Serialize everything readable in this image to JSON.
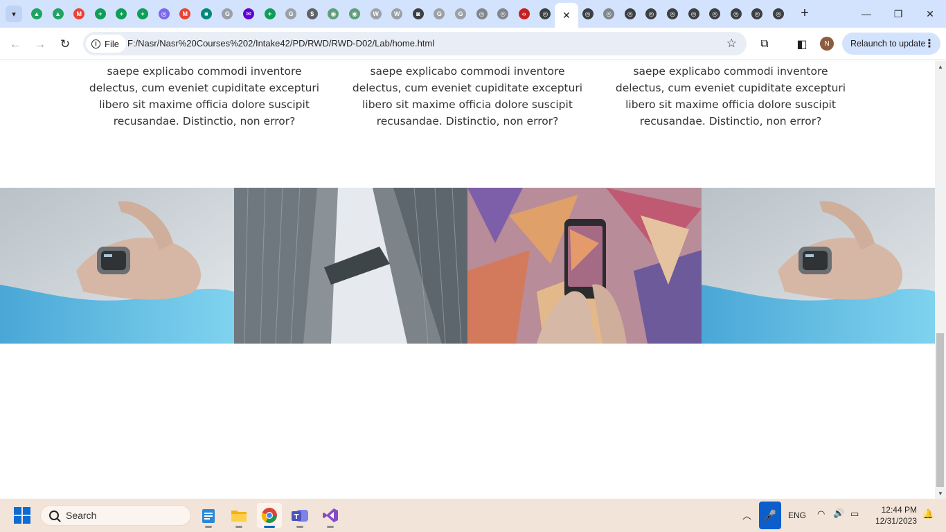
{
  "browser": {
    "tabs": [
      {
        "icon": "google-drive-icon",
        "color": "#1fa463",
        "glyph": "▲"
      },
      {
        "icon": "google-drive-icon",
        "color": "#1fa463",
        "glyph": "▲"
      },
      {
        "icon": "gmail-icon",
        "color": "#ea4335",
        "glyph": "M"
      },
      {
        "icon": "google-sheets-icon",
        "color": "#0f9d58",
        "glyph": "+"
      },
      {
        "icon": "google-sheets-icon",
        "color": "#0f9d58",
        "glyph": "+"
      },
      {
        "icon": "google-sheets-icon",
        "color": "#0f9d58",
        "glyph": "+"
      },
      {
        "icon": "extension-icon",
        "color": "#7b68ee",
        "glyph": "◎"
      },
      {
        "icon": "gmail-icon",
        "color": "#ea4335",
        "glyph": "M"
      },
      {
        "icon": "google-meet-icon",
        "color": "#00897b",
        "glyph": "■"
      },
      {
        "icon": "google-icon",
        "color": "#9aa0a6",
        "glyph": "G"
      },
      {
        "icon": "yahoo-mail-icon",
        "color": "#6001d2",
        "glyph": "✉"
      },
      {
        "icon": "google-sheets-icon",
        "color": "#0f9d58",
        "glyph": "+"
      },
      {
        "icon": "google-icon",
        "color": "#9aa0a6",
        "glyph": "G"
      },
      {
        "icon": "dollar-icon",
        "color": "#5f6368",
        "glyph": "$"
      },
      {
        "icon": "site-icon",
        "color": "#5f9e7a",
        "glyph": "◉"
      },
      {
        "icon": "site-icon",
        "color": "#5f9e7a",
        "glyph": "◉"
      },
      {
        "icon": "wikipedia-icon",
        "color": "#9aa0a6",
        "glyph": "W"
      },
      {
        "icon": "wikipedia-icon",
        "color": "#9aa0a6",
        "glyph": "W"
      },
      {
        "icon": "site-icon",
        "color": "#3c4043",
        "glyph": "◙"
      },
      {
        "icon": "google-icon",
        "color": "#9aa0a6",
        "glyph": "G"
      },
      {
        "icon": "site-icon",
        "color": "#9aa0a6",
        "glyph": "G"
      },
      {
        "icon": "chrome-icon",
        "color": "#80868b",
        "glyph": "◎"
      },
      {
        "icon": "chrome-icon",
        "color": "#80868b",
        "glyph": "◎"
      },
      {
        "icon": "code-icon",
        "color": "#c5221f",
        "glyph": "‹›"
      },
      {
        "icon": "chrome-icon",
        "color": "#3c4043",
        "glyph": "◎"
      },
      {
        "icon": "close-icon",
        "color": "#1f1f1f",
        "glyph": "✕",
        "active": true
      },
      {
        "icon": "chrome-icon",
        "color": "#3c4043",
        "glyph": "◎"
      },
      {
        "icon": "chrome-icon",
        "color": "#80868b",
        "glyph": "◎"
      },
      {
        "icon": "chrome-icon",
        "color": "#3c4043",
        "glyph": "◎"
      },
      {
        "icon": "chrome-icon",
        "color": "#3c4043",
        "glyph": "◎"
      },
      {
        "icon": "chrome-icon",
        "color": "#3c4043",
        "glyph": "◎"
      },
      {
        "icon": "chrome-icon",
        "color": "#3c4043",
        "glyph": "◎"
      },
      {
        "icon": "chrome-icon",
        "color": "#3c4043",
        "glyph": "◎"
      },
      {
        "icon": "chrome-icon",
        "color": "#3c4043",
        "glyph": "◎"
      },
      {
        "icon": "chrome-icon",
        "color": "#3c4043",
        "glyph": "◎"
      },
      {
        "icon": "chrome-icon",
        "color": "#3c4043",
        "glyph": "◎"
      }
    ],
    "omnibox": {
      "chip_label": "File",
      "url": "F:/Nasr/Nasr%20Courses%202/Intake42/PD/RWD/RWD-D02/Lab/home.html"
    },
    "profile_initial": "N",
    "relaunch_label": "Relaunch to update"
  },
  "page": {
    "columns": [
      {
        "text": "adipisicing elit. Minus error, asperiores saepe explicabo commodi inventore delectus, cum eveniet cupiditate excepturi libero sit maxime officia dolore suscipit recusandae. Distinctio, non error?"
      },
      {
        "text": "adipisicing elit. Minus error, asperiores saepe explicabo commodi inventore delectus, cum eveniet cupiditate excepturi libero sit maxime officia dolore suscipit recusandae. Distinctio, non error?"
      },
      {
        "text": "adipisicing elit. Minus error, asperiores saepe explicabo commodi inventore delectus, cum eveniet cupiditate excepturi libero sit maxime officia dolore suscipit recusandae. Distinctio, non error?"
      }
    ],
    "gallery": [
      "smartwatch-photo",
      "skyscrapers-photo",
      "phone-mural-photo",
      "smartwatch-photo"
    ]
  },
  "taskbar": {
    "search_label": "Search",
    "language": "ENG",
    "time": "12:44 PM",
    "date": "12/31/2023"
  }
}
